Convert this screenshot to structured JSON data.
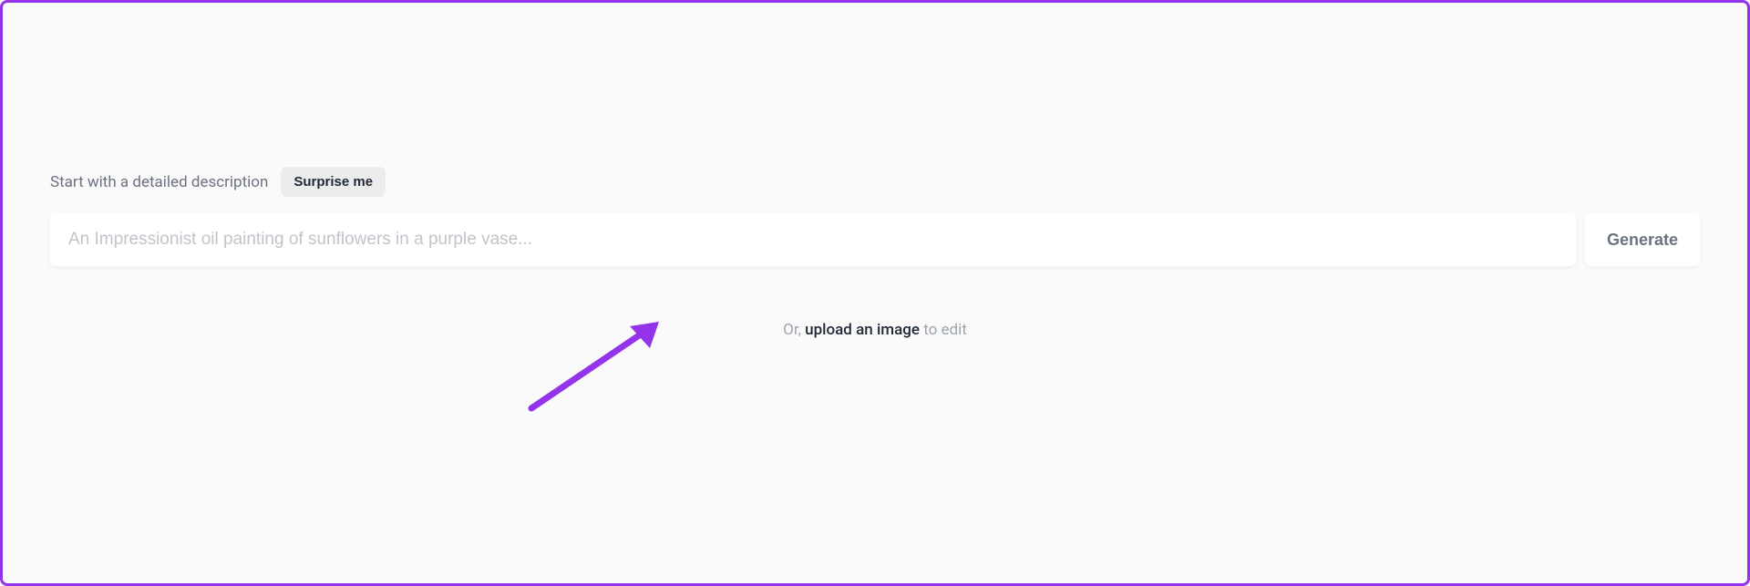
{
  "header": {
    "label": "Start with a detailed description",
    "surprise_button": "Surprise me"
  },
  "prompt": {
    "placeholder": "An Impressionist oil painting of sunflowers in a purple vase...",
    "value": ""
  },
  "generate_button": "Generate",
  "upload": {
    "prefix": "Or, ",
    "link": "upload an image",
    "suffix": " to edit"
  },
  "colors": {
    "border": "#9333ea",
    "arrow": "#9333ea"
  }
}
